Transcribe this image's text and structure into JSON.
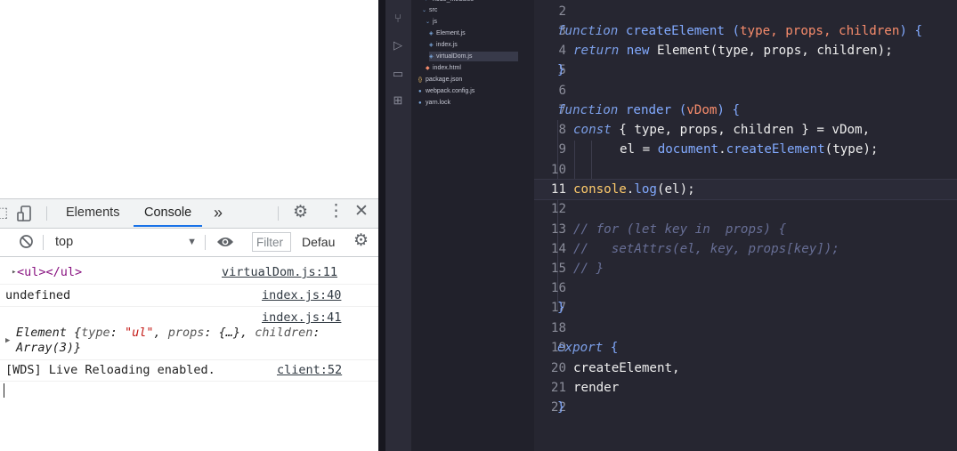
{
  "devtools": {
    "tabs": [
      "Elements",
      "Console"
    ],
    "more_label": "»",
    "context": "top",
    "filter_placeholder": "Filter",
    "levels_label": "Defau"
  },
  "console": {
    "row1": {
      "open": "<ul>",
      "close": "</ul>",
      "source": "virtualDom.js:11"
    },
    "row2": {
      "text": "undefined",
      "source": "index.js:40"
    },
    "row3": {
      "source": "index.js:41",
      "obj_name": "Element",
      "part_a": " {",
      "k_type": "type",
      "v_type": "\"ul\"",
      "k_props": "props",
      "v_props": "{…}",
      "k_children": "children",
      "v_children": "Array(3)",
      "end": "}"
    },
    "row4": {
      "text": "[WDS] Live Reloading enabled.",
      "source": "client:52"
    }
  },
  "explorer": {
    "items": [
      {
        "name": "node_modules",
        "icon": "folder-icon"
      },
      {
        "name": "src",
        "icon": "folder-icon"
      },
      {
        "name": "js",
        "icon": "folder-icon"
      },
      {
        "name": "Element.js",
        "icon": "js-file-icon"
      },
      {
        "name": "index.js",
        "icon": "js-file-icon"
      },
      {
        "name": "virtualDom.js",
        "icon": "js-file-icon"
      },
      {
        "name": "index.html",
        "icon": "html-file-icon"
      },
      {
        "name": "package.json",
        "icon": "json-file-icon"
      },
      {
        "name": "webpack.config.js",
        "icon": "webpack-file-icon"
      },
      {
        "name": "yarn.lock",
        "icon": "yarn-file-icon"
      }
    ]
  },
  "code": {
    "line_numbers": [
      "2",
      "3",
      "4",
      "5",
      "6",
      "7",
      "8",
      "9",
      "10",
      "11",
      "12",
      "13",
      "14",
      "15",
      "16",
      "17",
      "18",
      "19",
      "20",
      "21",
      "22"
    ],
    "current_line": "11",
    "l3": {
      "kw": "function",
      "name": " createElement ",
      "open": "(",
      "p": "type, props, children",
      "close": ") {"
    },
    "l4": {
      "kw": "return",
      "rest_kw": " new",
      "rest": " Element(type, props, children);"
    },
    "l5": "}",
    "l7": {
      "kw": "function",
      "name": " render ",
      "open": "(",
      "p": "vDom",
      "close": ") {"
    },
    "l8": {
      "kw": "const",
      "rest": " { type, props, children } = vDom,"
    },
    "l9": {
      "a": "el = ",
      "obj": "document",
      "dot": ".",
      "fn": "createElement",
      "rest": "(type);"
    },
    "l11": {
      "a": "console",
      "dot": ".",
      "fn": "log",
      "rest": "(el);"
    },
    "l13": "// for (let key in  props) {",
    "l14": "//   setAttrs(el, key, props[key]);",
    "l15": "// }",
    "l17": "}",
    "l19": {
      "kw": "export",
      "rest": " {"
    },
    "l20": "createElement,",
    "l21": "render",
    "l22": "}"
  }
}
